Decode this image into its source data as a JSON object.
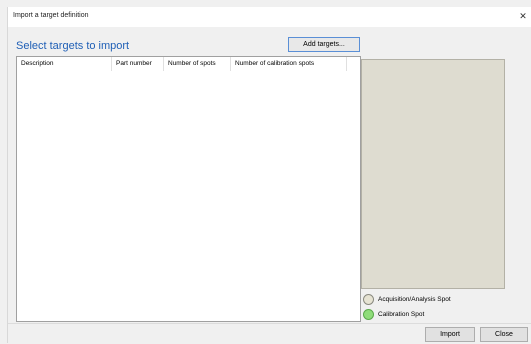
{
  "window": {
    "title": "Import a target definition",
    "close_glyph": "✕"
  },
  "heading": "Select targets to import",
  "add_button": "Add targets...",
  "table": {
    "columns": [
      "Description",
      "Part number",
      "Number of spots",
      "Number of calibration spots"
    ],
    "rows": []
  },
  "legend": [
    {
      "label": "Acquisition/Analysis Spot",
      "color": "#e6e3d3"
    },
    {
      "label": "Calibration Spot",
      "color": "#8fdc7a"
    }
  ],
  "footer": {
    "import_label": "Import",
    "close_label": "Close"
  }
}
